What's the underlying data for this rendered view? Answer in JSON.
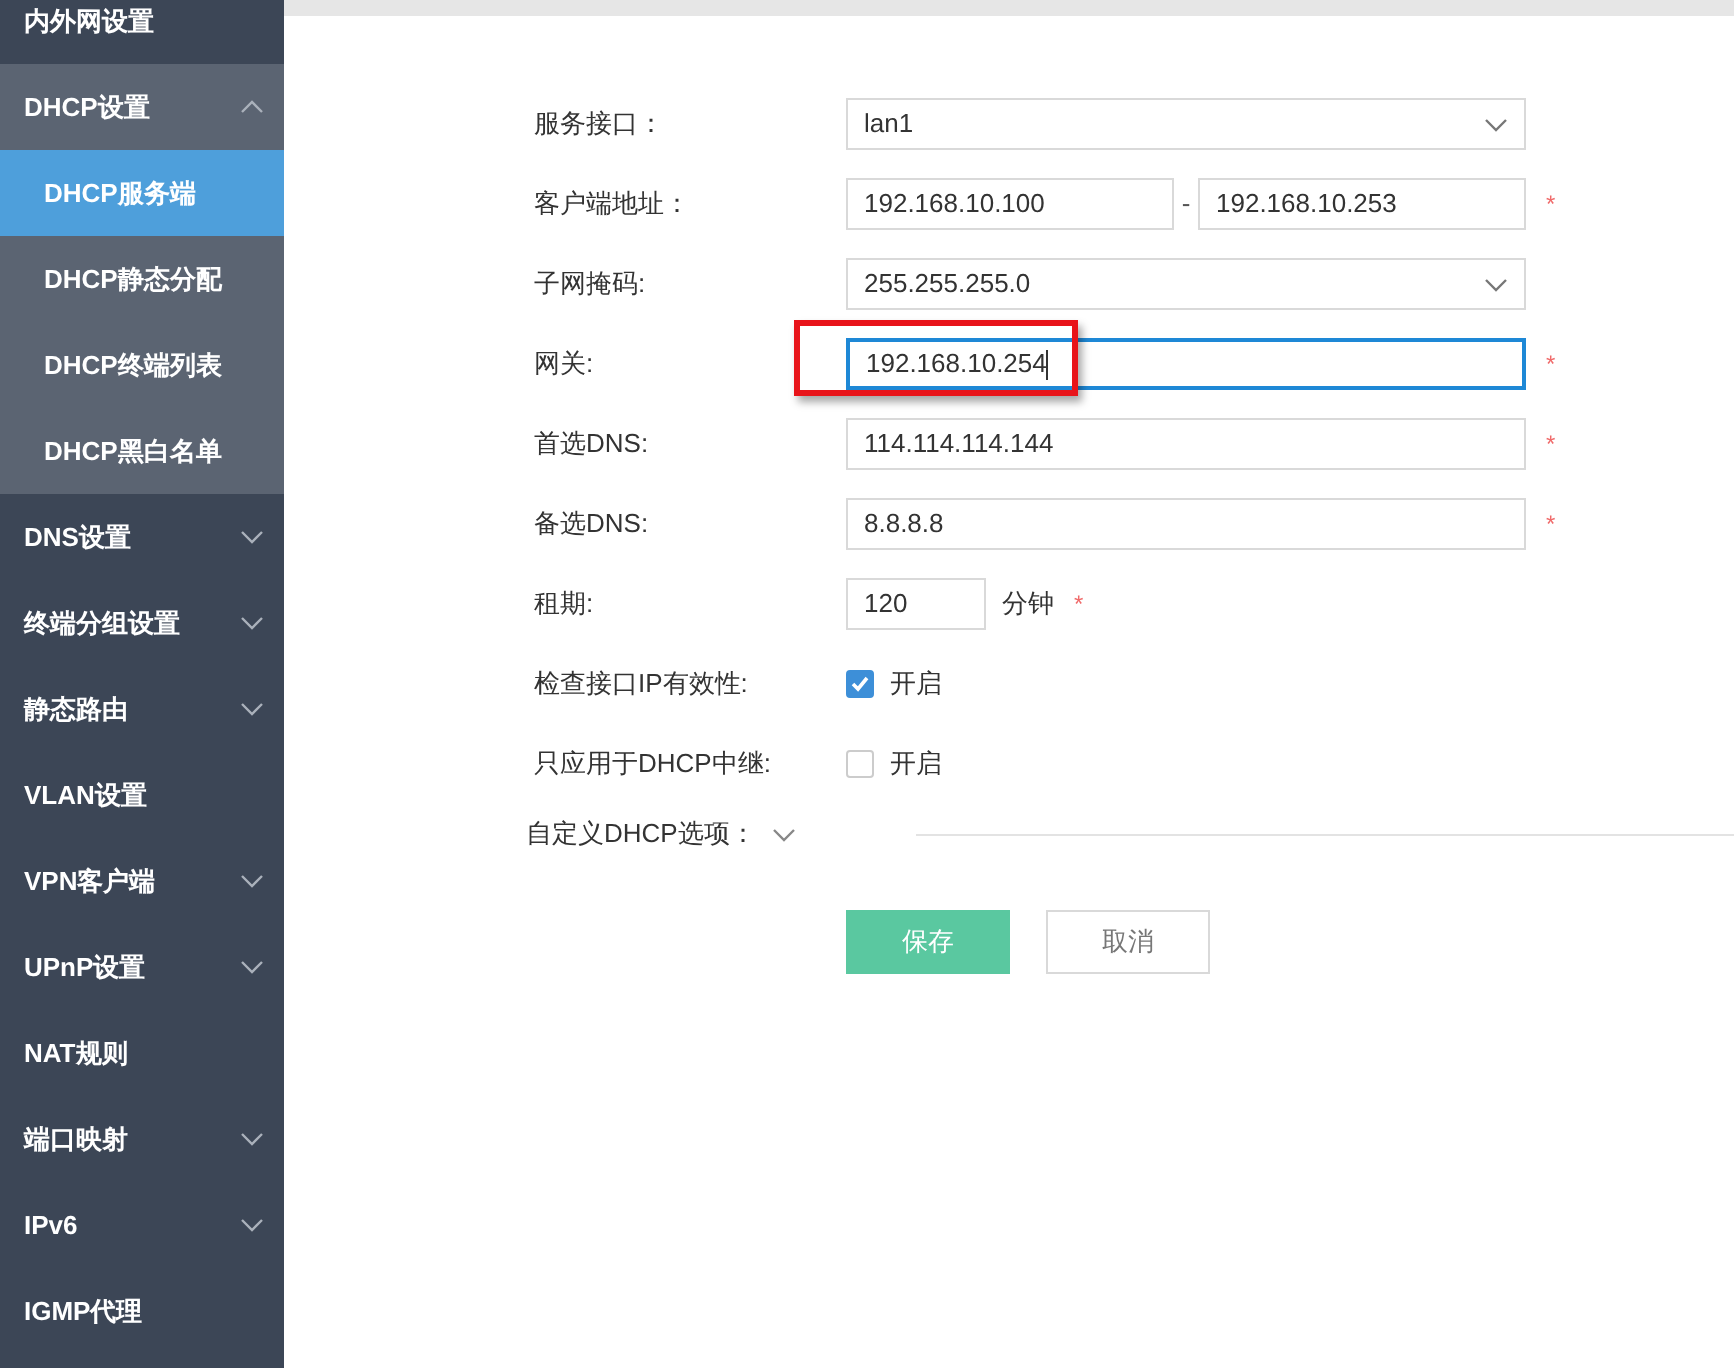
{
  "sidebar": {
    "items": [
      {
        "kind": "link",
        "label": "内外网设置",
        "selected": false
      },
      {
        "kind": "group",
        "label": "DHCP设置",
        "expanded": true,
        "selected": false,
        "children": [
          {
            "label": "DHCP服务端",
            "selected": true
          },
          {
            "label": "DHCP静态分配",
            "selected": false
          },
          {
            "label": "DHCP终端列表",
            "selected": false
          },
          {
            "label": "DHCP黑白名单",
            "selected": false
          }
        ]
      },
      {
        "kind": "group",
        "label": "DNS设置",
        "expanded": false,
        "selected": false
      },
      {
        "kind": "group",
        "label": "终端分组设置",
        "expanded": false,
        "selected": false
      },
      {
        "kind": "group",
        "label": "静态路由",
        "expanded": false,
        "selected": false
      },
      {
        "kind": "link",
        "label": "VLAN设置",
        "selected": false
      },
      {
        "kind": "group",
        "label": "VPN客户端",
        "expanded": false,
        "selected": false
      },
      {
        "kind": "group",
        "label": "UPnP设置",
        "expanded": false,
        "selected": false
      },
      {
        "kind": "link",
        "label": "NAT规则",
        "selected": false
      },
      {
        "kind": "group",
        "label": "端口映射",
        "expanded": false,
        "selected": false
      },
      {
        "kind": "group",
        "label": "IPv6",
        "expanded": false,
        "selected": false
      },
      {
        "kind": "link",
        "label": "IGMP代理",
        "selected": false
      }
    ]
  },
  "form": {
    "fields": [
      {
        "kind": "select",
        "label": "服务接口：",
        "value": "lan1"
      },
      {
        "kind": "range",
        "label": "客户端地址：",
        "value": "192.168.10.100",
        "separator": "-",
        "value_end": "192.168.10.253",
        "required_mark": "*"
      },
      {
        "kind": "select",
        "label": "子网掩码:",
        "value": "255.255.255.0"
      },
      {
        "kind": "text",
        "label": "网关:",
        "value": "192.168.10.254",
        "required_mark": "*",
        "focused": true,
        "highlighted": true
      },
      {
        "kind": "text",
        "label": "首选DNS:",
        "value": "114.114.114.144",
        "required_mark": "*",
        "focused": false,
        "highlighted": false
      },
      {
        "kind": "text",
        "label": "备选DNS:",
        "value": "8.8.8.8",
        "required_mark": "*",
        "focused": false,
        "highlighted": false
      },
      {
        "kind": "number",
        "label": "租期:",
        "value": "120",
        "unit": "分钟",
        "required_mark": "*"
      },
      {
        "kind": "checkbox",
        "label": "检查接口IP有效性:",
        "checked": true,
        "option": "开启"
      },
      {
        "kind": "checkbox",
        "label": "只应用于DHCP中继:",
        "checked": false,
        "option": "开启"
      }
    ],
    "custom_options": {
      "label": "自定义DHCP选项：",
      "expanded": false
    },
    "buttons": [
      {
        "kind": "primary",
        "label": "保存"
      },
      {
        "kind": "secondary",
        "label": "取消"
      }
    ]
  }
}
